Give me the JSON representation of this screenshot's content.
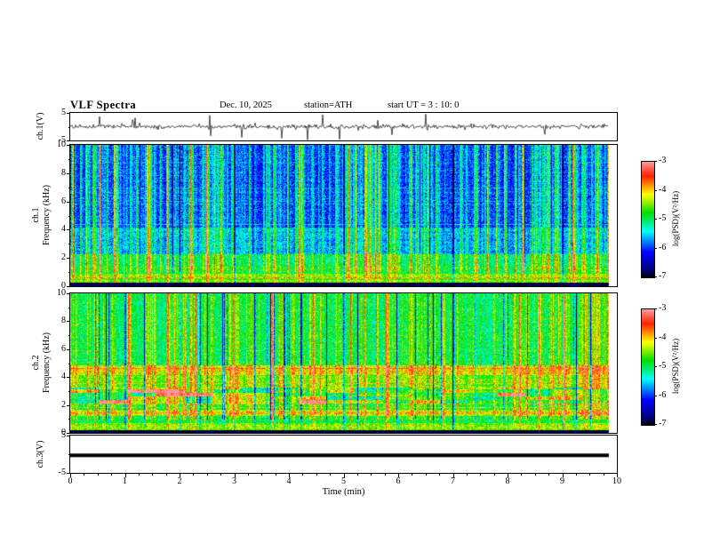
{
  "title": {
    "main": "VLF Spectra",
    "date": "Dec. 10, 2025",
    "station": "station=ATH",
    "start_ut": "start UT =  3 : 10: 0"
  },
  "xaxis": {
    "label": "Time (min)",
    "ticks": [
      0,
      1,
      2,
      3,
      4,
      5,
      6,
      7,
      8,
      9,
      10
    ],
    "range": [
      0,
      10
    ]
  },
  "yaxes": {
    "ch1_wave": {
      "label": "ch.1(V)",
      "ticks": [
        5,
        -5
      ],
      "range": [
        -5,
        5
      ]
    },
    "ch1_spec": {
      "label_channel": "ch.1",
      "label_freq": "Frequency (kHz)",
      "ticks": [
        10,
        8,
        6,
        4,
        2,
        0
      ],
      "range": [
        0,
        10
      ]
    },
    "ch2_spec": {
      "label_channel": "ch.2",
      "label_freq": "Frequency (kHz)",
      "ticks": [
        10,
        8,
        6,
        4,
        2,
        0
      ],
      "range": [
        0,
        10
      ]
    },
    "ch3_wave": {
      "label": "ch.3(V)",
      "ticks": [
        5,
        -5
      ],
      "range": [
        -5,
        5
      ]
    }
  },
  "colorbar": {
    "label": "log(PSD)(V²/Hz)",
    "ticks": [
      -3,
      -4,
      -5,
      -6,
      -7
    ],
    "range_low": -7,
    "range_high": -3
  },
  "chart_data": [
    {
      "type": "line",
      "name": "ch.1 voltage waveform",
      "ylabel": "ch.1(V)",
      "ylim": [
        -5,
        5
      ],
      "xlim": [
        0,
        10
      ],
      "xlabel": "Time (min)",
      "description": "broadband noise centered near 0 V with frequent impulsive spikes reaching about ±5 V (sferics)"
    },
    {
      "type": "heatmap",
      "name": "ch.1 spectrogram",
      "ylabel": "ch.1 Frequency (kHz)",
      "ylim": [
        0,
        10
      ],
      "xlim": [
        0,
        10
      ],
      "value_label": "log(PSD)(V²/Hz)",
      "value_range": [
        -7,
        -3
      ],
      "bands": [
        {
          "f0": 0.0,
          "f1": 0.28,
          "logpsd": -6.9
        },
        {
          "f0": 0.28,
          "f1": 0.9,
          "logpsd": -4.6
        },
        {
          "f0": 0.9,
          "f1": 1.4,
          "logpsd": -5.0
        },
        {
          "f0": 1.4,
          "f1": 2.3,
          "logpsd": -5.2
        },
        {
          "f0": 2.3,
          "f1": 4.2,
          "logpsd": -5.8
        },
        {
          "f0": 4.2,
          "f1": 10.0,
          "logpsd": -6.1
        }
      ],
      "transients": "dense vertical broadband striations (sferics) rising to about -4.5 across all frequencies"
    },
    {
      "type": "heatmap",
      "name": "ch.2 spectrogram",
      "ylabel": "ch.2 Frequency (kHz)",
      "ylim": [
        0,
        10
      ],
      "xlim": [
        0,
        10
      ],
      "value_label": "log(PSD)(V²/Hz)",
      "value_range": [
        -7,
        -3
      ],
      "bands": [
        {
          "f0": 0.0,
          "f1": 0.25,
          "logpsd": -6.9
        },
        {
          "f0": 0.25,
          "f1": 0.75,
          "logpsd": -4.5
        },
        {
          "f0": 0.75,
          "f1": 1.25,
          "logpsd": -5.0
        },
        {
          "f0": 1.25,
          "f1": 1.7,
          "logpsd": -4.4
        },
        {
          "f0": 1.7,
          "f1": 2.1,
          "logpsd": -5.0
        },
        {
          "f0": 2.1,
          "f1": 3.3,
          "logpsd": -4.9
        },
        {
          "f0": 3.3,
          "f1": 4.2,
          "logpsd": -4.7
        },
        {
          "f0": 4.2,
          "f1": 4.9,
          "logpsd": -4.3
        },
        {
          "f0": 4.9,
          "f1": 10.0,
          "logpsd": -5.1
        }
      ],
      "transients": "vertical bright (≈ -4.3) and dark (≈ -6.5) striations; patchy enhancements between 2.1 and 3.3 kHz"
    },
    {
      "type": "line",
      "name": "ch.3 voltage waveform",
      "ylabel": "ch.3(V)",
      "ylim": [
        -5,
        5
      ],
      "xlim": [
        0,
        10
      ],
      "xlabel": "Time (min)",
      "description": "flat constant trace at about -0.3 V for the full record"
    }
  ],
  "render": {
    "seed": 42,
    "data_end_min": 9.85,
    "colormap": [
      [
        0.0,
        "#000000"
      ],
      [
        0.07,
        "#000080"
      ],
      [
        0.22,
        "#0000ff"
      ],
      [
        0.4,
        "#00ffff"
      ],
      [
        0.56,
        "#00dd00"
      ],
      [
        0.72,
        "#ffff00"
      ],
      [
        0.88,
        "#ff2200"
      ],
      [
        1.0,
        "#ff9999"
      ]
    ],
    "spec1": {
      "noise": 0.06,
      "streak": {
        "g": 0.16,
        "p": 0.1,
        "amt": 0.4
      },
      "dark": {
        "p": 0.02,
        "amt": 0.18
      }
    },
    "spec2": {
      "noise": 0.06,
      "streak": {
        "g": 0.12,
        "p": 0.08,
        "amt": 0.3
      },
      "dark": {
        "p": 0.06,
        "amt": 0.32
      },
      "patch_band": [
        2.1,
        3.3
      ],
      "patch_amp": 0.38
    },
    "wave1": {
      "noise_v": 0.4,
      "spike_p": 0.03,
      "spike_v": 3.2
    },
    "wave3": {
      "level_v": -0.3,
      "thickness": 4
    }
  }
}
